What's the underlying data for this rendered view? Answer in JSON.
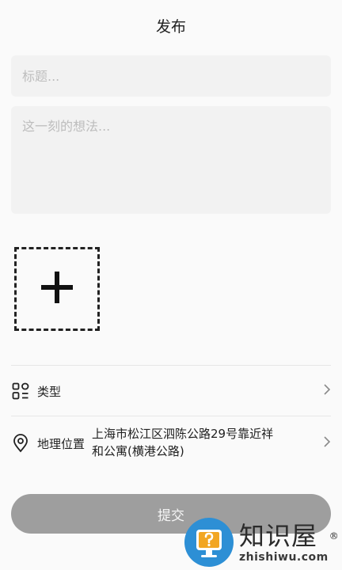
{
  "header": {
    "title": "发布"
  },
  "form": {
    "title_placeholder": "标题...",
    "thought_placeholder": "这一刻的想法..."
  },
  "rows": {
    "type": {
      "label": "类型",
      "icon": "grid-icon"
    },
    "location": {
      "label": "地理位置",
      "icon": "location-pin-icon",
      "value_line1": "上海市松江区泗陈公路29号靠近祥",
      "value_line2": "和公寓(横港公路)"
    }
  },
  "submit": {
    "label": "提交"
  },
  "watermark": {
    "name": "知识屋",
    "reg": "®",
    "domain": "zhishiwu.com"
  },
  "colors": {
    "submit_bg": "#9e9e9e",
    "field_bg": "#f2f2f2",
    "watermark_blue": "#2d8fd5"
  }
}
